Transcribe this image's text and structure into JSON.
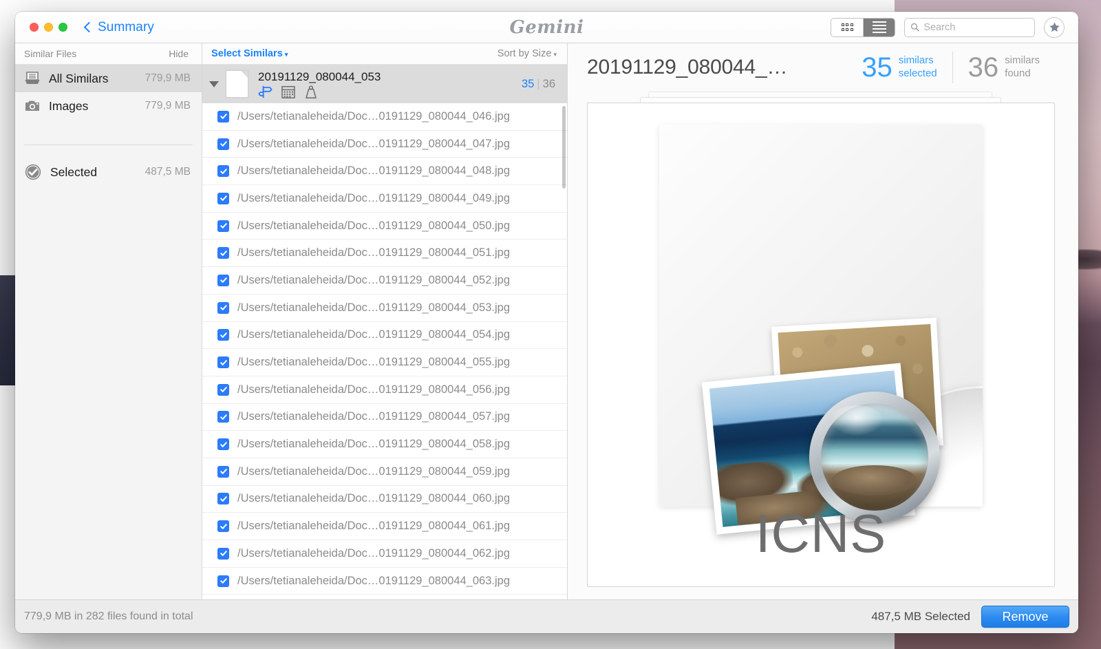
{
  "window": {
    "back_label": "Summary",
    "brand": "Gemini"
  },
  "toolbar": {
    "grid_view_icon": "grid-view-icon",
    "list_view_icon": "list-view-icon",
    "search_placeholder": "Search",
    "search_value": "",
    "star_icon": "star-icon"
  },
  "sidebar": {
    "header": "Similar Files",
    "hide_label": "Hide",
    "items": [
      {
        "label": "All Similars",
        "size": "779,9 MB",
        "icon": "tray-icon",
        "selected": true
      },
      {
        "label": "Images",
        "size": "779,9 MB",
        "icon": "camera-icon",
        "selected": false
      }
    ],
    "selected_row": {
      "label": "Selected",
      "size": "487,5 MB",
      "icon": "check-circle-icon"
    }
  },
  "list": {
    "select_similars_label": "Select Similars",
    "sort_label": "Sort by Size",
    "caret": "▾",
    "group": {
      "name": "20191129_080044_053",
      "selected_count": "35",
      "divider": "|",
      "found_count": "36",
      "icons": [
        "signpost-icon",
        "calendar-icon",
        "weight-icon"
      ]
    },
    "rows": [
      {
        "path": "/Users/tetianaleheida/Doc…0191129_080044_046.jpg",
        "checked": true
      },
      {
        "path": "/Users/tetianaleheida/Doc…0191129_080044_047.jpg",
        "checked": true
      },
      {
        "path": "/Users/tetianaleheida/Doc…0191129_080044_048.jpg",
        "checked": true
      },
      {
        "path": "/Users/tetianaleheida/Doc…0191129_080044_049.jpg",
        "checked": true
      },
      {
        "path": "/Users/tetianaleheida/Doc…0191129_080044_050.jpg",
        "checked": true
      },
      {
        "path": "/Users/tetianaleheida/Doc…0191129_080044_051.jpg",
        "checked": true
      },
      {
        "path": "/Users/tetianaleheida/Doc…0191129_080044_052.jpg",
        "checked": true
      },
      {
        "path": "/Users/tetianaleheida/Doc…0191129_080044_053.jpg",
        "checked": true
      },
      {
        "path": "/Users/tetianaleheida/Doc…0191129_080044_054.jpg",
        "checked": true
      },
      {
        "path": "/Users/tetianaleheida/Doc…0191129_080044_055.jpg",
        "checked": true
      },
      {
        "path": "/Users/tetianaleheida/Doc…0191129_080044_056.jpg",
        "checked": true
      },
      {
        "path": "/Users/tetianaleheida/Doc…0191129_080044_057.jpg",
        "checked": true
      },
      {
        "path": "/Users/tetianaleheida/Doc…0191129_080044_058.jpg",
        "checked": true
      },
      {
        "path": "/Users/tetianaleheida/Doc…0191129_080044_059.jpg",
        "checked": true
      },
      {
        "path": "/Users/tetianaleheida/Doc…0191129_080044_060.jpg",
        "checked": true
      },
      {
        "path": "/Users/tetianaleheida/Doc…0191129_080044_061.jpg",
        "checked": true
      },
      {
        "path": "/Users/tetianaleheida/Doc…0191129_080044_062.jpg",
        "checked": true
      },
      {
        "path": "/Users/tetianaleheida/Doc…0191129_080044_063.jpg",
        "checked": true
      }
    ]
  },
  "detail": {
    "title": "20191129_080044_…",
    "selected_count": "35",
    "selected_label_line1": "similars",
    "selected_label_line2": "selected",
    "found_count": "36",
    "found_label_line1": "similars",
    "found_label_line2": "found",
    "preview_format_label": "ICNS"
  },
  "footer": {
    "total_text": "779,9 MB in 282 files found in total",
    "selected_text": "487,5 MB Selected",
    "remove_label": "Remove"
  },
  "colors": {
    "accent_blue": "#1a82ff",
    "stat_blue": "#37a0ff",
    "checkbox_blue": "#2b7cff",
    "remove_blue": "#2d8bf0",
    "muted_gray": "#8b8b8b"
  }
}
